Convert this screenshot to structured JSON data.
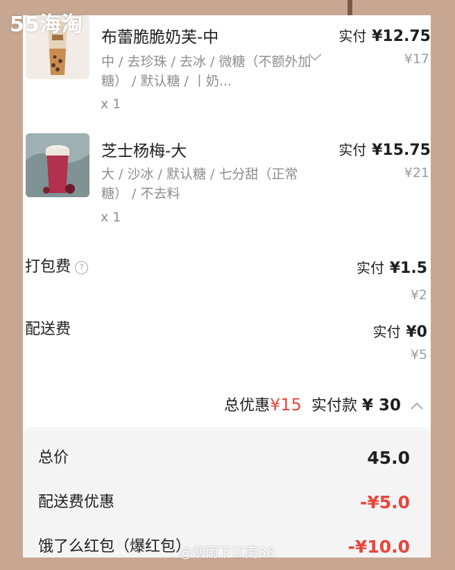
{
  "watermark": {
    "top": "55海淘",
    "bottom": "@烟雨下江南88"
  },
  "items": [
    {
      "name": "布蕾脆脆奶芙-中",
      "paid_label": "实付",
      "paid_price": "¥12.75",
      "orig_price": "¥17",
      "spec": "中 / 去珍珠 / 去冰 / 微糖（不额外加糖） / 默认糖 / 丨奶...",
      "qty": "x 1"
    },
    {
      "name": "芝士杨梅-大",
      "paid_label": "实付",
      "paid_price": "¥15.75",
      "orig_price": "¥21",
      "spec": "大 / 沙冰 / 默认糖 / 七分甜（正常糖） / 不去料",
      "qty": "x 1"
    }
  ],
  "fees": {
    "packing": {
      "label": "打包费",
      "paid_label": "实付",
      "paid_price": "¥1.5",
      "orig_price": "¥2"
    },
    "delivery": {
      "label": "配送费",
      "paid_label": "实付",
      "paid_price": "¥0",
      "orig_price": "¥5"
    }
  },
  "summary": {
    "discount_label": "总优惠",
    "discount_value": "¥15",
    "paid_label": "实付款",
    "paid_value": "¥ 30"
  },
  "breakdown": [
    {
      "label": "总价",
      "value": "45.0"
    },
    {
      "label": "配送费优惠",
      "value": "-¥5.0"
    },
    {
      "label": "饿了么红包（爆红包）",
      "value": "-¥10.0"
    }
  ],
  "colors": {
    "accent_red": "#e8453c",
    "background": "#c7a792"
  }
}
